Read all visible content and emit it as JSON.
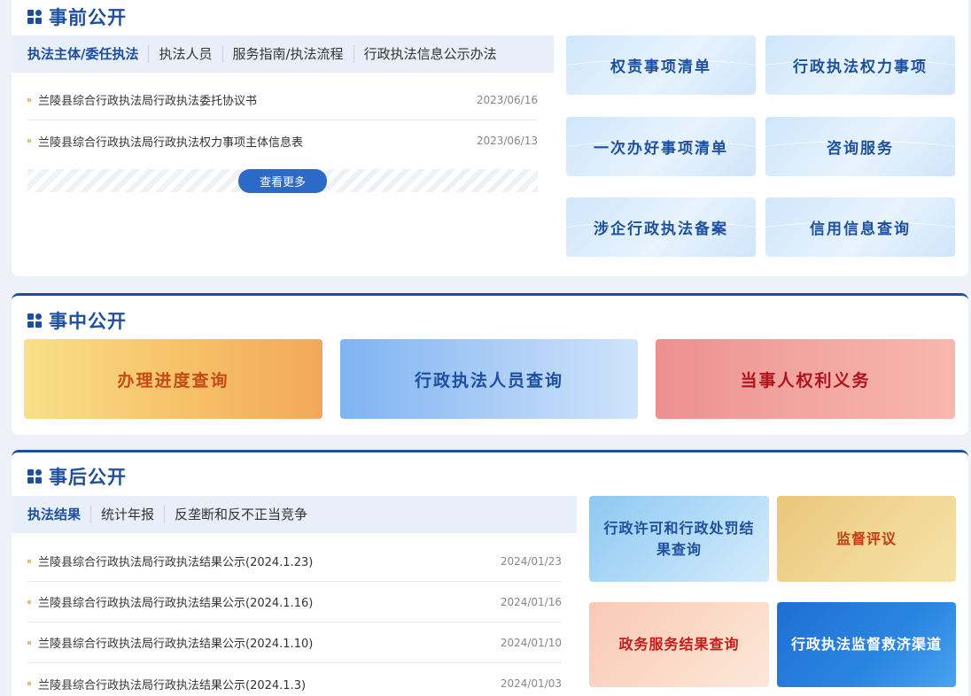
{
  "before": {
    "title": "事前公开",
    "tabs": [
      "执法主体/委任执法",
      "执法人员",
      "服务指南/执法流程",
      "行政执法信息公示办法"
    ],
    "news": [
      {
        "title": "兰陵县综合行政执法局行政执法委托协议书",
        "date": "2023/06/16"
      },
      {
        "title": "兰陵县综合行政执法局行政执法权力事项主体信息表",
        "date": "2023/06/13"
      }
    ],
    "more_label": "查看更多",
    "tiles": [
      "权责事项清单",
      "行政执法权力事项",
      "一次办好事项清单",
      "咨询服务",
      "涉企行政执法备案",
      "信用信息查询"
    ]
  },
  "during": {
    "title": "事中公开",
    "tiles": [
      "办理进度查询",
      "行政执法人员查询",
      "当事人权利义务"
    ]
  },
  "after": {
    "title": "事后公开",
    "tabs": [
      "执法结果",
      "统计年报",
      "反垄断和反不正当竞争"
    ],
    "news": [
      {
        "title": "兰陵县综合行政执法局行政执法结果公示(2024.1.23)",
        "date": "2024/01/23"
      },
      {
        "title": "兰陵县综合行政执法局行政执法结果公示(2024.1.16)",
        "date": "2024/01/16"
      },
      {
        "title": "兰陵县综合行政执法局行政执法结果公示(2024.1.10)",
        "date": "2024/01/10"
      },
      {
        "title": "兰陵县综合行政执法局行政执法结果公示(2024.1.3)",
        "date": "2024/01/03"
      }
    ],
    "tiles": [
      "行政许可和行政处罚结果查询",
      "监督评议",
      "政务服务结果查询",
      "行政执法监督救济渠道"
    ]
  }
}
